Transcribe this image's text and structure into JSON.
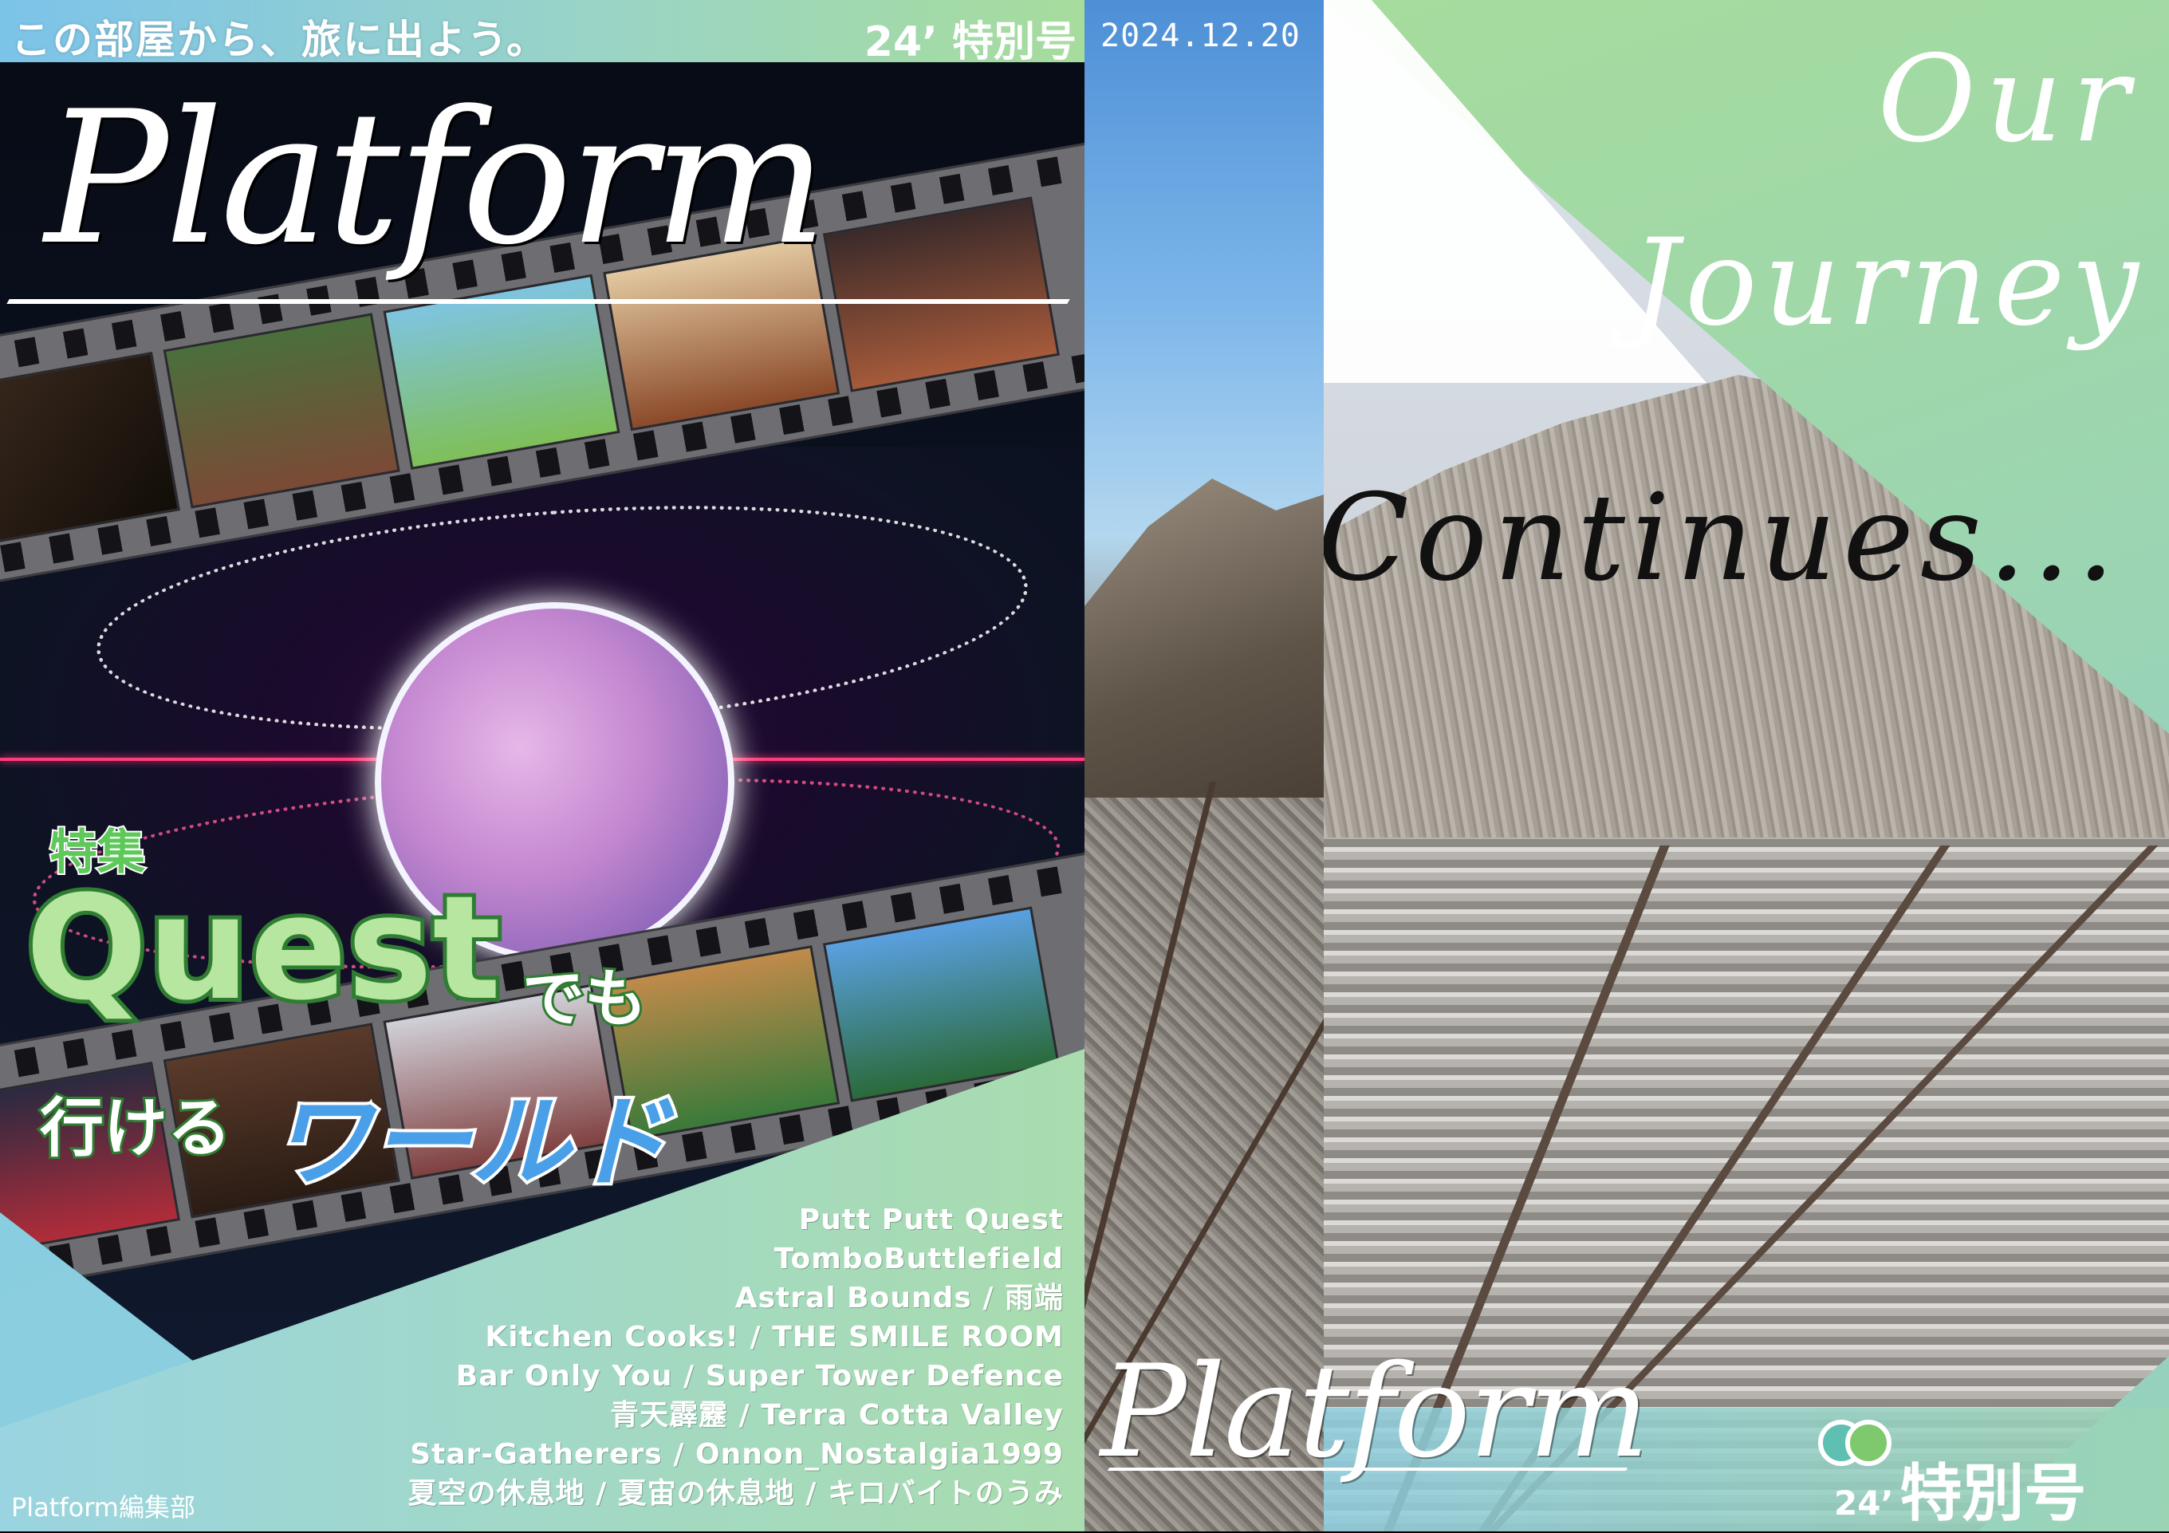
{
  "front": {
    "tagline": "この部屋から、旅に出よう。",
    "issue": "24’ 特別号",
    "title": "Platform",
    "feature_label": "特集",
    "feature_quest": "Quest",
    "feature_demo": "でも",
    "feature_ikeru": "行ける",
    "feature_world": "ワールド",
    "games": [
      "Putt Putt Quest",
      "TomboButtlefield",
      "Astral Bounds / 雨端",
      "Kitchen Cooks! / THE SMILE ROOM",
      "Bar Only You / Super Tower Defence",
      "青天霹靂 / Terra Cotta Valley",
      "Star-Gatherers / Onnon_Nostalgia1999",
      "夏空の休息地 / 夏宙の休息地 / キロバイトのうみ"
    ],
    "editor": "Platform編集部"
  },
  "spine": {
    "date": "2024.12.20"
  },
  "back": {
    "slogan_line1": "Our",
    "slogan_line2": "Journey",
    "slogan_line3": "Continues...",
    "title": "Platform",
    "issue_year": "24’",
    "issue_label": "特別号"
  },
  "colors": {
    "green": "#a6dc9c",
    "blue": "#7cc3ea",
    "teal": "#86c8d6",
    "quest_green": "#2f7d32",
    "world_blue": "#4aa0e8",
    "laser_pink": "#ff3d7a"
  }
}
